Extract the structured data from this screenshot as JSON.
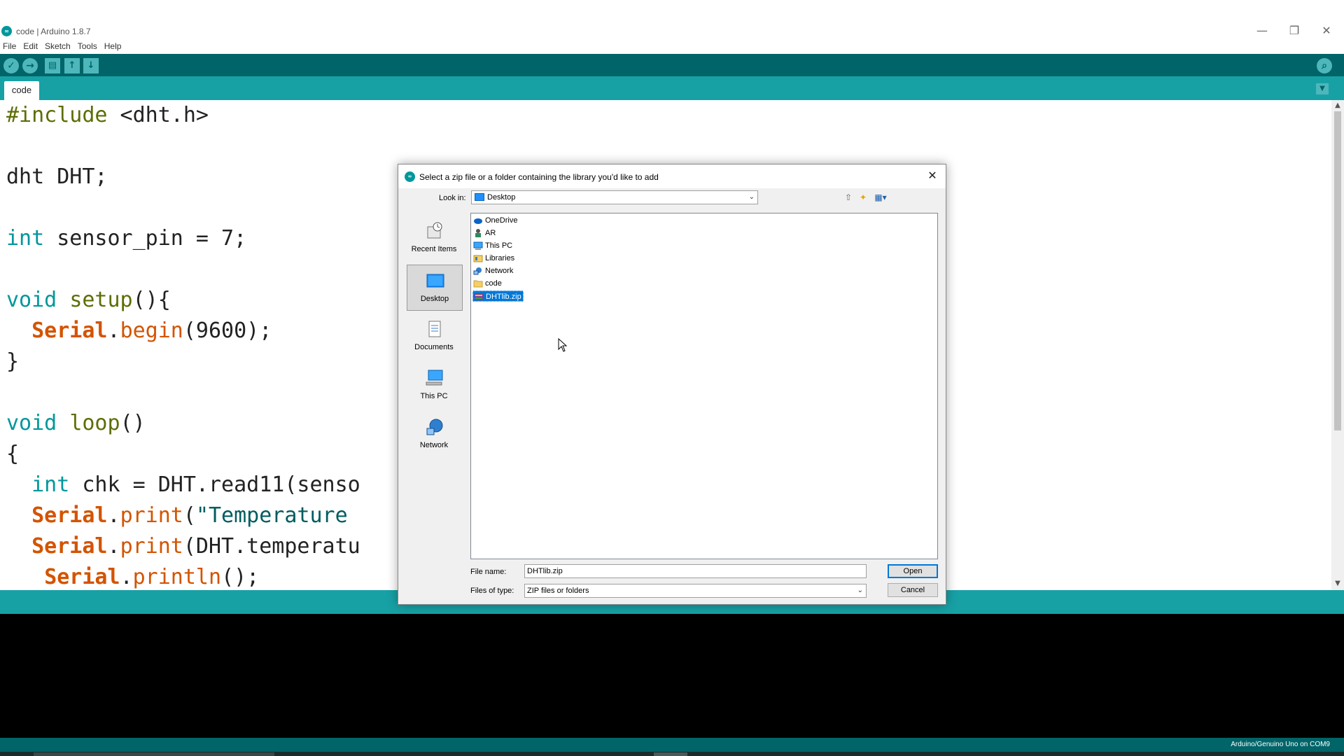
{
  "window": {
    "title": "code | Arduino 1.8.7",
    "app_icon_glyph": "∞",
    "minimize_glyph": "—",
    "restore_glyph": "❐",
    "close_glyph": "✕"
  },
  "menu": [
    "File",
    "Edit",
    "Sketch",
    "Tools",
    "Help"
  ],
  "toolbar": {
    "verify_glyph": "✓",
    "upload_glyph": "→",
    "new_glyph": "▤",
    "open_glyph": "↑",
    "save_glyph": "↓",
    "serial_monitor_glyph": "⌕"
  },
  "tabs": {
    "active": "code",
    "menu_glyph": "▼"
  },
  "code": {
    "l1_a": "#include",
    "l1_b": " <dht.h>",
    "l2_a": "dht",
    "l2_b": " DHT;",
    "l3_a": "int",
    "l3_b": " sensor_pin = 7;",
    "l4_a": "void",
    "l4_b": " ",
    "l4_c": "setup",
    "l4_d": "(){",
    "l5_a": "  ",
    "l5_b": "Serial",
    "l5_c": ".",
    "l5_d": "begin",
    "l5_e": "(9600);",
    "l6": "}",
    "l7_a": "void",
    "l7_b": " ",
    "l7_c": "loop",
    "l7_d": "()",
    "l8": "{",
    "l9_a": "  ",
    "l9_b": "int",
    "l9_c": " chk = DHT.read11(senso",
    "l10_a": "  ",
    "l10_b": "Serial",
    "l10_c": ".",
    "l10_d": "print",
    "l10_e": "(",
    "l10_f": "\"Temperature",
    "l11_a": "  ",
    "l11_b": "Serial",
    "l11_c": ".",
    "l11_d": "print",
    "l11_e": "(DHT.temperatu",
    "l12_a": "   ",
    "l12_b": "Serial",
    "l12_c": ".",
    "l12_d": "println",
    "l12_e": "();"
  },
  "scrollbar": {
    "up_glyph": "▲",
    "down_glyph": "▼"
  },
  "status": {
    "board": "Arduino/Genuino Uno on COM9"
  },
  "dialog": {
    "title": "Select a zip file or a folder containing the library you'd like to add",
    "icon_glyph": "∞",
    "close_glyph": "✕",
    "look_in_label": "Look in:",
    "look_in_value": "Desktop",
    "combo_arrow": "⌄",
    "up_folder_glyph": "⇧",
    "new_folder_glyph": "✦",
    "view_menu_glyph": "▦▾",
    "places": [
      {
        "label": "Recent Items"
      },
      {
        "label": "Desktop"
      },
      {
        "label": "Documents"
      },
      {
        "label": "This PC"
      },
      {
        "label": "Network"
      }
    ],
    "files": [
      {
        "name": "OneDrive"
      },
      {
        "name": "AR"
      },
      {
        "name": "This PC"
      },
      {
        "name": "Libraries"
      },
      {
        "name": "Network"
      },
      {
        "name": "code"
      },
      {
        "name": "DHTlib.zip"
      }
    ],
    "file_name_label": "File name:",
    "file_name_value": "DHTlib.zip",
    "files_of_type_label": "Files of type:",
    "files_of_type_value": "ZIP files or folders",
    "open_label": "Open",
    "cancel_label": "Cancel"
  },
  "colors": {
    "teal_dark": "#006468",
    "teal": "#17a1a5",
    "selection": "#0078d7"
  }
}
